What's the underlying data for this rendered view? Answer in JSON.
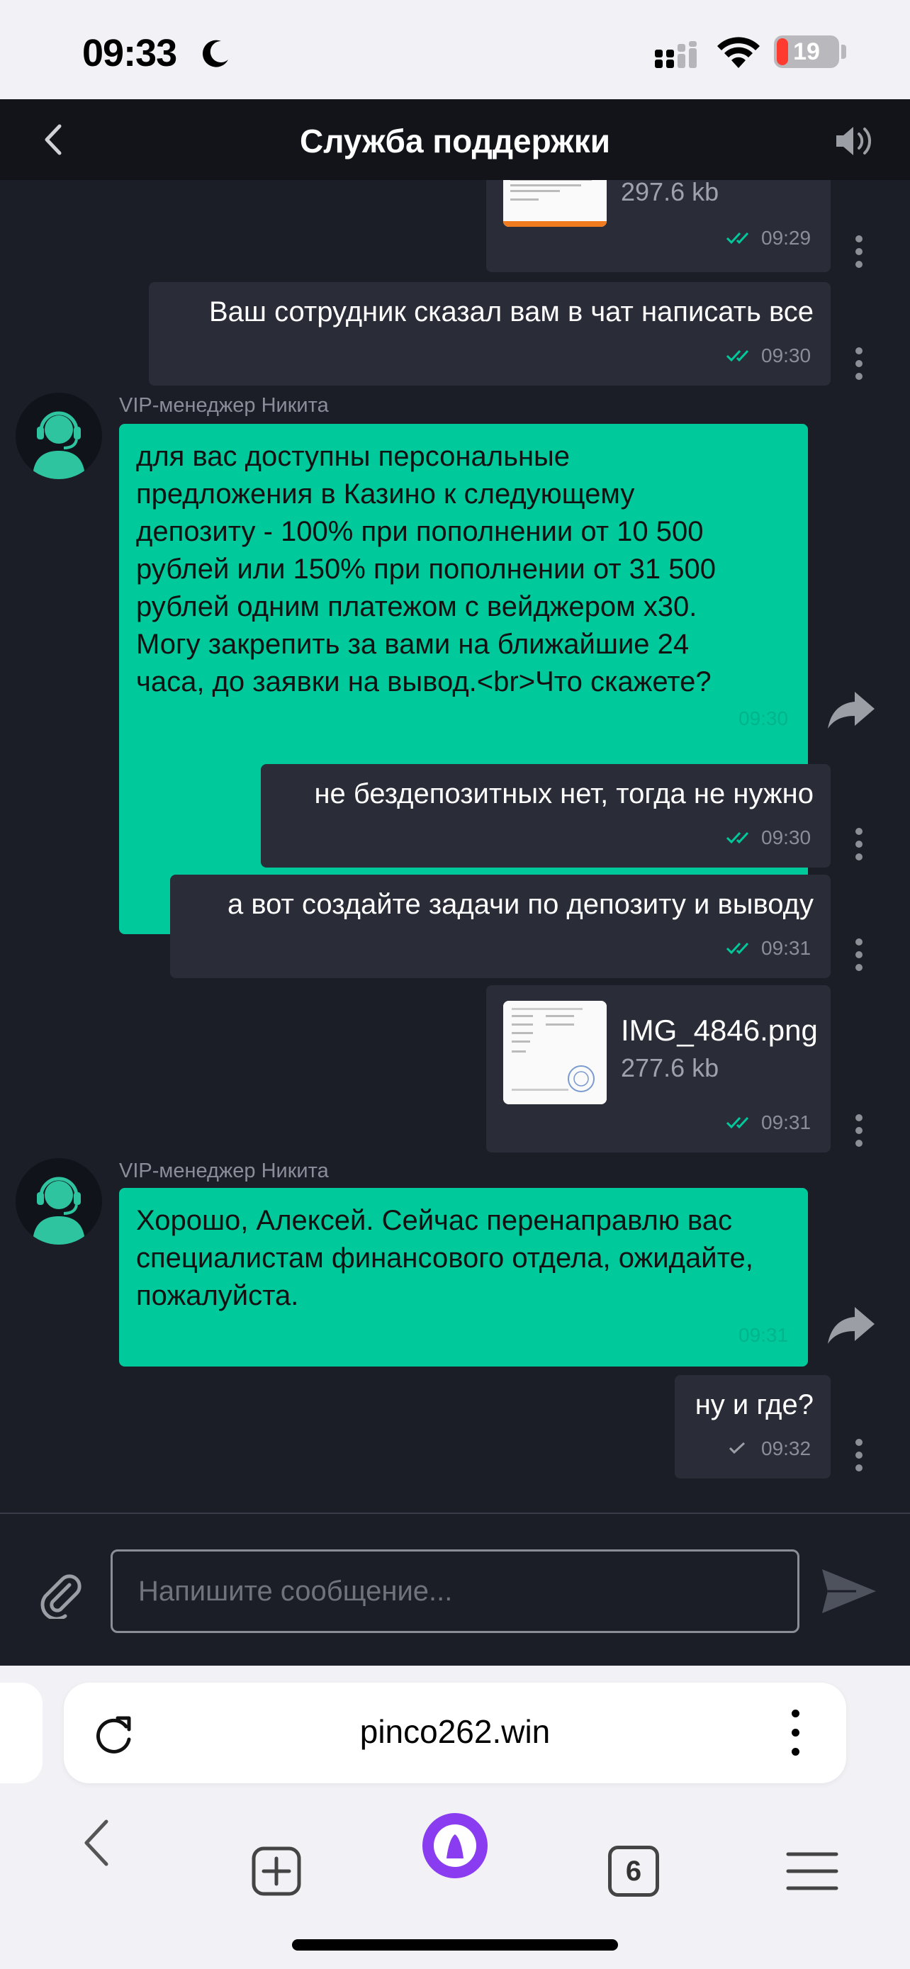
{
  "status_bar": {
    "time": "09:33",
    "battery": "19",
    "battery_level": 0.19
  },
  "header": {
    "title": "Служба поддержки"
  },
  "messages": [
    {
      "type": "file",
      "file_size": "297.6 kb",
      "time": "09:29",
      "status": "read"
    },
    {
      "type": "user",
      "text": "Ваш сотрудник сказал вам в чат написать все",
      "time": "09:30",
      "status": "read"
    },
    {
      "type": "agent",
      "sender": "VIP-менеджер Никита",
      "lines": [
        "для вас доступны персональные",
        "предложения в Казино к следующему",
        "депозиту - 100% при пополнении от 10 500",
        "рублей или 150% при пополнении от 31 500",
        "рублей одним платежом с вейджером х30.",
        "Могу закрепить за вами на ближайшие 24",
        "часа, до заявки на вывод.<br>Что скажете?"
      ],
      "time": "09:30"
    },
    {
      "type": "user",
      "text": "не бездепозитных нет, тогда не нужно",
      "time": "09:30",
      "status": "read"
    },
    {
      "type": "user",
      "text": "а вот создайте задачи по депозиту и выводу",
      "time": "09:31",
      "status": "read"
    },
    {
      "type": "file",
      "file_name": "IMG_4846.png",
      "file_size": "277.6 kb",
      "time": "09:31",
      "status": "read"
    },
    {
      "type": "agent",
      "sender": "VIP-менеджер Никита",
      "lines": [
        "Хорошо, Алексей. Сейчас перенаправлю вас",
        "специалистам финансового отдела, ожидайте,",
        "пожалуйста."
      ],
      "time": "09:31"
    },
    {
      "type": "user",
      "text": "ну и где?",
      "time": "09:32",
      "status": "sent"
    }
  ],
  "composer": {
    "placeholder": "Напишите сообщение..."
  },
  "browser": {
    "url": "pinco262.win",
    "tab_count": "6"
  },
  "colors": {
    "agent_bubble": "#00c99c",
    "user_bubble": "#2a2d38",
    "read_ticks": "#00c99c",
    "background": "#1b1e27"
  }
}
